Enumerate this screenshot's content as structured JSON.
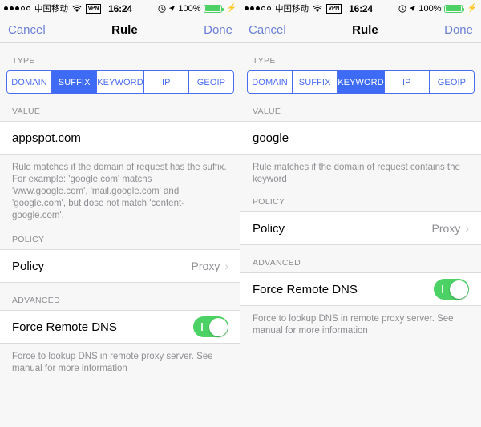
{
  "panels": [
    {
      "status": {
        "signal_dots_filled": 3,
        "signal_dots_empty": 2,
        "carrier": "中国移动",
        "wifi_icon": "wifi-icon",
        "vpn_badge": "VPN",
        "time": "16:24",
        "alarm_icon": "alarm-clock-icon",
        "location_icon": "location-arrow-icon",
        "battery_percent": "100%",
        "battery_color": "#4cd264",
        "charging_icon": "lightning-bolt-icon"
      },
      "nav": {
        "cancel": "Cancel",
        "title": "Rule",
        "done": "Done"
      },
      "type_section": {
        "header": "TYPE",
        "options": [
          "DOMAIN",
          "SUFFIX",
          "KEYWORD",
          "IP",
          "GEOIP"
        ],
        "selected": "SUFFIX",
        "accent": "#3d6bf5"
      },
      "value_section": {
        "header": "VALUE",
        "value": "appspot.com",
        "placeholder": "",
        "footnote": "Rule matches if the domain of request has the suffix. For example: 'google.com' matchs 'www.google.com', 'mail.google.com' and 'google.com', but dose not match 'content-google.com'."
      },
      "policy_section": {
        "header": "POLICY",
        "label": "Policy",
        "value": "Proxy",
        "chevron_icon": "chevron-right-icon"
      },
      "advanced_section": {
        "header": "ADVANCED",
        "label": "Force Remote DNS",
        "toggle_on": true,
        "toggle_color": "#4cd264",
        "footnote": "Force to lookup DNS in remote proxy server. See manual for more information"
      }
    },
    {
      "status": {
        "signal_dots_filled": 3,
        "signal_dots_empty": 2,
        "carrier": "中国移动",
        "wifi_icon": "wifi-icon",
        "vpn_badge": "VPN",
        "time": "16:24",
        "alarm_icon": "alarm-clock-icon",
        "location_icon": "location-arrow-icon",
        "battery_percent": "100%",
        "battery_color": "#4cd264",
        "charging_icon": "lightning-bolt-icon"
      },
      "nav": {
        "cancel": "Cancel",
        "title": "Rule",
        "done": "Done"
      },
      "type_section": {
        "header": "TYPE",
        "options": [
          "DOMAIN",
          "SUFFIX",
          "KEYWORD",
          "IP",
          "GEOIP"
        ],
        "selected": "KEYWORD",
        "accent": "#3d6bf5"
      },
      "value_section": {
        "header": "VALUE",
        "value": "google",
        "placeholder": "",
        "footnote": "Rule matches if the domain of request contains the keyword"
      },
      "policy_section": {
        "header": "POLICY",
        "label": "Policy",
        "value": "Proxy",
        "chevron_icon": "chevron-right-icon"
      },
      "advanced_section": {
        "header": "ADVANCED",
        "label": "Force Remote DNS",
        "toggle_on": true,
        "toggle_color": "#4cd264",
        "footnote": "Force to lookup DNS in remote proxy server. See manual for more information"
      }
    }
  ]
}
